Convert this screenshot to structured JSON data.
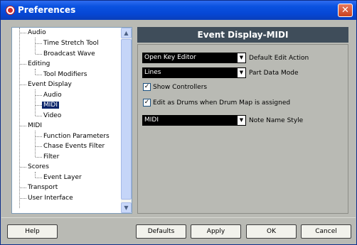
{
  "window": {
    "title": "Preferences"
  },
  "tree": {
    "items": [
      {
        "label": "Audio"
      },
      {
        "label": "Time Stretch Tool"
      },
      {
        "label": "Broadcast Wave"
      },
      {
        "label": "Editing"
      },
      {
        "label": "Tool Modifiers"
      },
      {
        "label": "Event Display"
      },
      {
        "label": "Audio"
      },
      {
        "label": "MIDI",
        "selected": true
      },
      {
        "label": "Video"
      },
      {
        "label": "MIDI"
      },
      {
        "label": "Function Parameters"
      },
      {
        "label": "Chase Events Filter"
      },
      {
        "label": "Filter"
      },
      {
        "label": "Scores"
      },
      {
        "label": "Event Layer"
      },
      {
        "label": "Transport"
      },
      {
        "label": "User Interface"
      }
    ]
  },
  "panel": {
    "title": "Event Display-MIDI",
    "default_edit_action": {
      "value": "Open Key Editor",
      "label": "Default Edit Action"
    },
    "part_data_mode": {
      "value": "Lines",
      "label": "Part Data Mode"
    },
    "show_controllers": {
      "label": "Show Controllers",
      "checked": true
    },
    "edit_as_drums": {
      "label": "Edit as Drums when Drum Map is assigned",
      "checked": true
    },
    "note_name_style": {
      "value": "MIDI",
      "label": "Note Name Style"
    }
  },
  "buttons": {
    "help": "Help",
    "defaults": "Defaults",
    "apply": "Apply",
    "ok": "OK",
    "cancel": "Cancel"
  }
}
